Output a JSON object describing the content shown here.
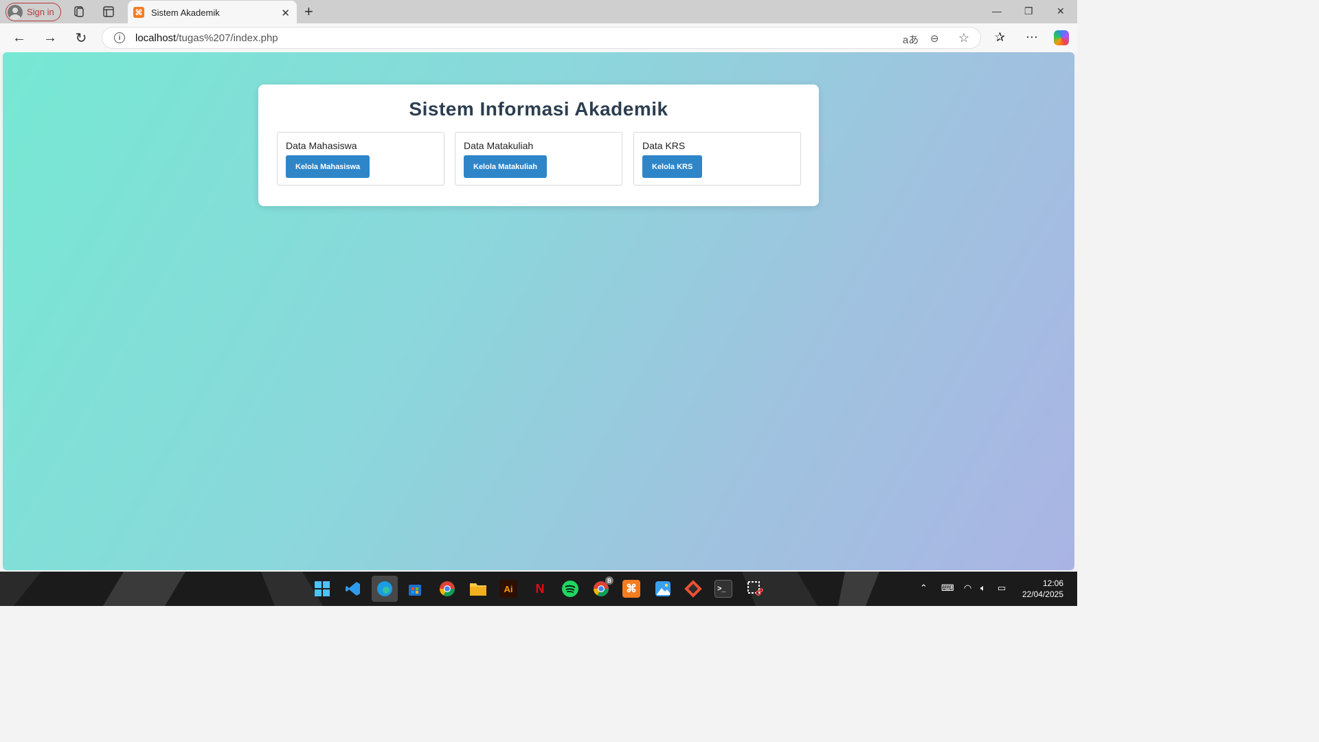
{
  "browser": {
    "signin_label": "Sign in",
    "tab_title": "Sistem Akademik",
    "tab_favicon_glyph": "⌘",
    "url_host": "localhost",
    "url_path": "/tugas%207/index.php",
    "icons": [
      "back-icon",
      "forward-icon",
      "refresh-icon",
      "info-icon",
      "translate-icon",
      "zoom-out-icon",
      "favorite-star-icon",
      "favorites-icon",
      "more-icon",
      "copilot-icon"
    ]
  },
  "page": {
    "title": "Sistem Informasi Akademik",
    "modules": [
      {
        "title": "Data Mahasiswa",
        "button": "Kelola Mahasiswa"
      },
      {
        "title": "Data Matakuliah",
        "button": "Kelola Matakuliah"
      },
      {
        "title": "Data KRS",
        "button": "Kelola KRS"
      }
    ]
  },
  "taskbar": {
    "apps": [
      "windows-start",
      "vscode",
      "edge",
      "microsoft-store",
      "chrome",
      "file-explorer",
      "adobe-illustrator",
      "netflix",
      "spotify",
      "chrome-profile",
      "xampp",
      "photos",
      "git",
      "terminal",
      "snipping-tool"
    ],
    "illustrator_label": "Ai",
    "netflix_label": "N",
    "chrome_badge": "B",
    "time": "12:06",
    "date": "22/04/2025"
  },
  "colors": {
    "button": "#2e86c9",
    "title": "#2c3e50",
    "gradient_start": "#76e8d3",
    "gradient_end": "#aab4e4"
  }
}
